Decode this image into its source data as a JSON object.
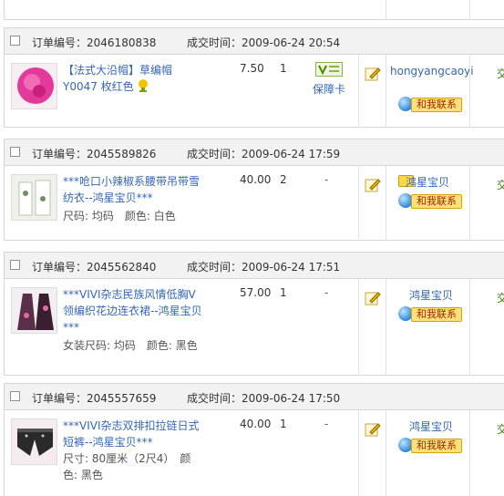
{
  "labels": {
    "order_no": "订单编号：",
    "deal_time": "成交时间：",
    "contact": "和我联系",
    "protect_card": "保障卡",
    "status_partial": "交"
  },
  "orders": [
    {
      "order_no": "2046180838",
      "deal_time": "2009-06-24 20:54",
      "title": "【法式大沿帽】草编帽Y0047 枚红色",
      "attrs": "",
      "price": "7.50",
      "qty": "1",
      "seller": "hongyangcaoyi",
      "has_protect_card": true,
      "thumb_color": "#e2399a"
    },
    {
      "order_no": "2045589826",
      "deal_time": "2009-06-24 17:59",
      "title": "***呛口小辣椒系腰带吊带雪纺衣--鸿星宝贝***",
      "attrs": "尺码: 均码　颜色: 白色",
      "price": "40.00",
      "qty": "2",
      "seller": "鸿星宝贝",
      "has_protect_card": false,
      "thumb_color": "#cfd8c8"
    },
    {
      "order_no": "2045562840",
      "deal_time": "2009-06-24 17:51",
      "title": "***VIVI杂志民族风情低胸V领编织花边连衣裙--鸿星宝贝***",
      "attrs": "女装尺码: 均码　颜色: 黑色",
      "price": "57.00",
      "qty": "1",
      "seller": "鸿星宝贝",
      "has_protect_card": false,
      "thumb_color": "#5a2f4a"
    },
    {
      "order_no": "2045557659",
      "deal_time": "2009-06-24 17:50",
      "title": "***VIVI杂志双排扣拉链日式短裤--鸿星宝贝***",
      "attrs": "尺寸: 80厘米（2尺4）　颜色: 黑色",
      "price": "40.00",
      "qty": "1",
      "seller": "鸿星宝贝",
      "has_protect_card": false,
      "thumb_color": "#2a2a2a"
    }
  ],
  "colors": {
    "link": "#3567b5",
    "header_bg": "#f2f2f2",
    "border": "#d6d6d6",
    "contact_btn": "#ffe07a"
  }
}
